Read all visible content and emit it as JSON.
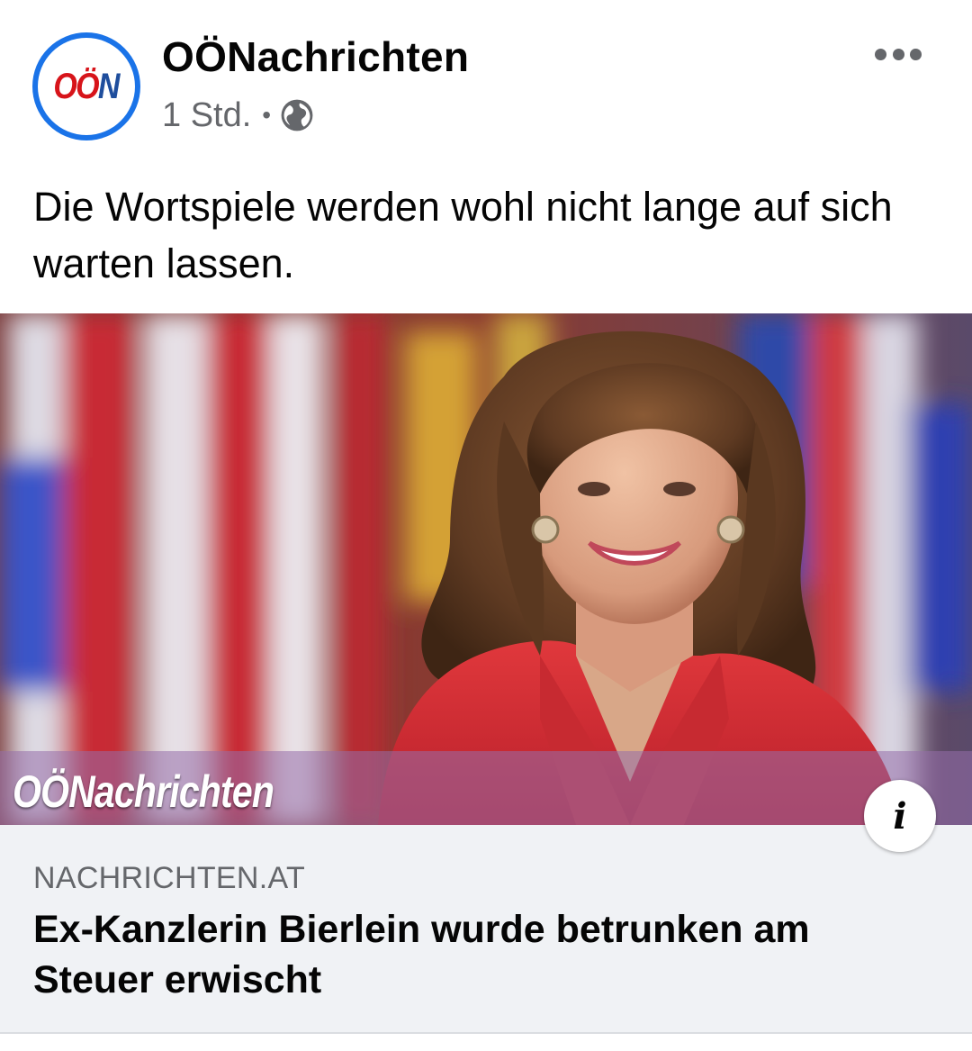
{
  "header": {
    "avatar_text_red": "OÖ",
    "avatar_text_blue": "N",
    "page_name": "OÖNachrichten",
    "timestamp": "1 Std.",
    "separator": "•",
    "audience_icon": "globe-icon",
    "more_icon": "more-horizontal-icon"
  },
  "post": {
    "text": "Die Wortspiele werden wohl nicht lange auf sich warten lassen."
  },
  "image": {
    "brand_overlay": "OÖNachrichten",
    "info_icon_label": "i"
  },
  "link_preview": {
    "domain": "NACHRICHTEN.AT",
    "title": "Ex-Kanzlerin Bierlein wurde betrunken am Steuer erwischt"
  },
  "colors": {
    "brand_blue": "#1a73e8",
    "logo_red": "#d7141a",
    "logo_blue": "#1f4e9d",
    "secondary_text": "#65676b",
    "link_bg": "#f0f2f5"
  }
}
